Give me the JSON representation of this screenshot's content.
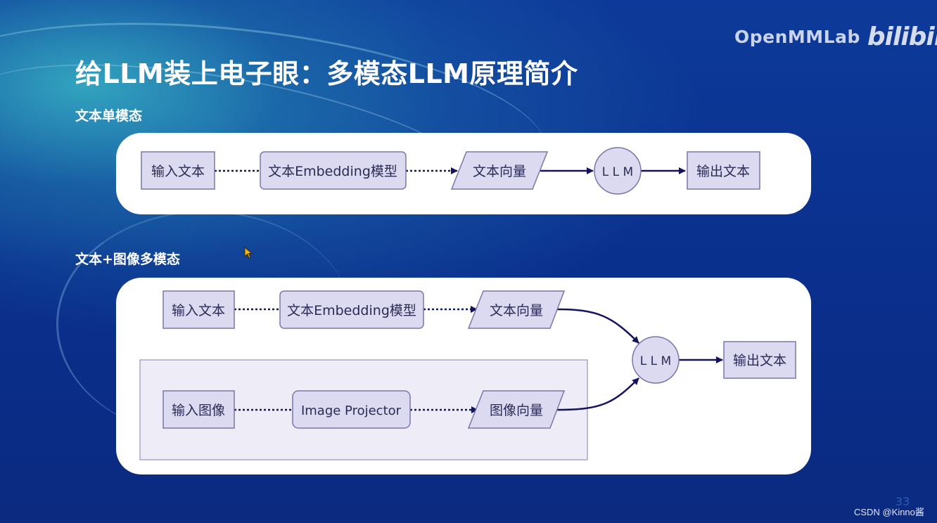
{
  "slide": {
    "title": "给LLM装上电子眼：多模态LLM原理简介",
    "brand": {
      "org": "OpenMMLab",
      "platform": "bilibili"
    },
    "page_number": "33",
    "watermark": "CSDN @Kinno酱"
  },
  "colors": {
    "background": "#0b2f8c",
    "panel": "#ffffff",
    "node_fill": "#dcdaf0",
    "node_stroke": "#7a76a8",
    "edge": "#14145e",
    "subgraph_fill": "#eeedf7",
    "subgraph_stroke": "#a9a7c9"
  },
  "diagrams": [
    {
      "section_label": "文本单模态",
      "nodes": [
        {
          "id": "t_input",
          "label": "输入文本",
          "shape": "rect"
        },
        {
          "id": "t_embed",
          "label": "文本Embedding模型",
          "shape": "rounded-rect"
        },
        {
          "id": "t_vec",
          "label": "文本向量",
          "shape": "parallelogram"
        },
        {
          "id": "llm",
          "label": "L L M",
          "shape": "circle"
        },
        {
          "id": "out",
          "label": "输出文本",
          "shape": "rect"
        }
      ],
      "edges": [
        {
          "from": "t_input",
          "to": "t_embed",
          "style": "dotted",
          "arrow": false
        },
        {
          "from": "t_embed",
          "to": "t_vec",
          "style": "dotted",
          "arrow": true
        },
        {
          "from": "t_vec",
          "to": "llm",
          "style": "solid",
          "arrow": true
        },
        {
          "from": "llm",
          "to": "out",
          "style": "solid",
          "arrow": true
        }
      ]
    },
    {
      "section_label": "文本+图像多模态",
      "nodes": [
        {
          "id": "t_input",
          "label": "输入文本",
          "shape": "rect"
        },
        {
          "id": "t_embed",
          "label": "文本Embedding模型",
          "shape": "rounded-rect"
        },
        {
          "id": "t_vec",
          "label": "文本向量",
          "shape": "parallelogram"
        },
        {
          "id": "i_input",
          "label": "输入图像",
          "shape": "rect"
        },
        {
          "id": "i_proj",
          "label": "Image Projector",
          "shape": "rounded-rect"
        },
        {
          "id": "i_vec",
          "label": "图像向量",
          "shape": "parallelogram"
        },
        {
          "id": "llm",
          "label": "L L M",
          "shape": "circle"
        },
        {
          "id": "out",
          "label": "输出文本",
          "shape": "rect"
        }
      ],
      "subgraph": {
        "contains": [
          "i_input",
          "i_proj",
          "i_vec"
        ]
      },
      "edges": [
        {
          "from": "t_input",
          "to": "t_embed",
          "style": "dotted",
          "arrow": false
        },
        {
          "from": "t_embed",
          "to": "t_vec",
          "style": "dotted",
          "arrow": true
        },
        {
          "from": "t_vec",
          "to": "llm",
          "style": "solid",
          "arrow": true
        },
        {
          "from": "i_input",
          "to": "i_proj",
          "style": "dotted",
          "arrow": false
        },
        {
          "from": "i_proj",
          "to": "i_vec",
          "style": "dotted",
          "arrow": true
        },
        {
          "from": "i_vec",
          "to": "llm",
          "style": "solid",
          "arrow": true
        },
        {
          "from": "llm",
          "to": "out",
          "style": "solid",
          "arrow": true
        }
      ]
    }
  ]
}
